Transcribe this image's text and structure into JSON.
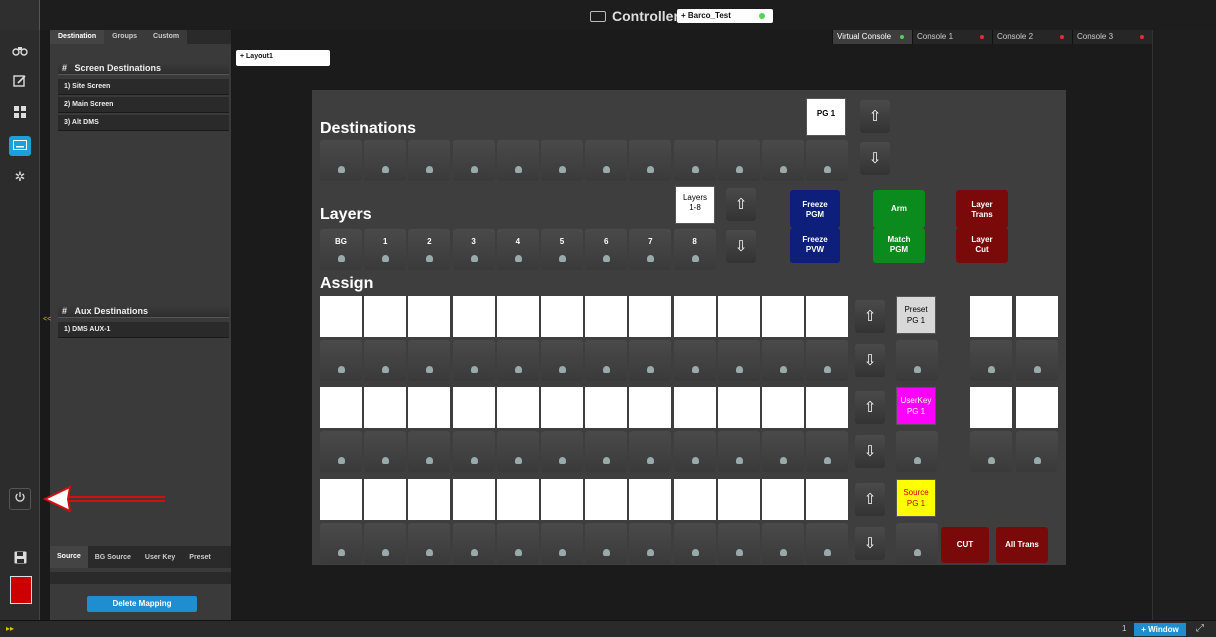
{
  "window": {
    "title": "Controller",
    "project_tab": "+ Barco_Test"
  },
  "panel": {
    "tabs": [
      "Destination",
      "Groups",
      "Custom"
    ],
    "screen_header": {
      "hash": "#",
      "label": "Screen Destinations"
    },
    "screens": [
      "1) Site Screen",
      "2) Main Screen",
      "3) Alt DMS"
    ],
    "aux_header": {
      "hash": "#",
      "label": "Aux Destinations"
    },
    "aux": [
      "1) DMS AUX-1"
    ],
    "bottom_tabs": [
      "Source",
      "BG Source",
      "User Key",
      "Preset"
    ],
    "delete_button": "Delete Mapping",
    "collapse": "<<"
  },
  "main": {
    "layout_tab": "+ Layout1",
    "consoles": [
      {
        "label": "Virtual Console",
        "dot": "#4fd24f"
      },
      {
        "label": "Console 1",
        "dot": "#e03030"
      },
      {
        "label": "Console 2",
        "dot": "#e03030"
      },
      {
        "label": "Console 3",
        "dot": "#e03030"
      }
    ]
  },
  "console": {
    "destinations_title": "Destinations",
    "pg_box": "PG 1",
    "layers_title": "Layers",
    "layers_box": "Layers\n1-8",
    "layer_keys": [
      "BG",
      "1",
      "2",
      "3",
      "4",
      "5",
      "6",
      "7",
      "8"
    ],
    "freeze_pgm": "Freeze\nPGM",
    "freeze_pvw": "Freeze\nPVW",
    "arm": "Arm",
    "match_pgm": "Match\nPGM",
    "layer_trans": "Layer\nTrans",
    "layer_cut": "Layer\nCut",
    "assign_title": "Assign",
    "preset_box": "Preset\nPG 1",
    "userkey_box": "UserKey\nPG 1",
    "source_box": "Source\nPG 1",
    "cut": "CUT",
    "all_trans": "All Trans",
    "colors": {
      "blue": "#0d1f7a",
      "green": "#0b8a1e",
      "red": "#7a0a0a",
      "magenta": "#ff00ff",
      "yellow": "#ffff00",
      "gray": "#d8d8d8"
    }
  },
  "statusbar": {
    "page": "1",
    "window_button": "+ Window",
    "bolt": "▸▸"
  },
  "icons": [
    "binoculars-icon",
    "edit-icon",
    "grid-icon",
    "keyboard-icon",
    "gear-icon",
    "power-icon",
    "save-icon",
    "barco-logo",
    "fullscreen-icon"
  ]
}
